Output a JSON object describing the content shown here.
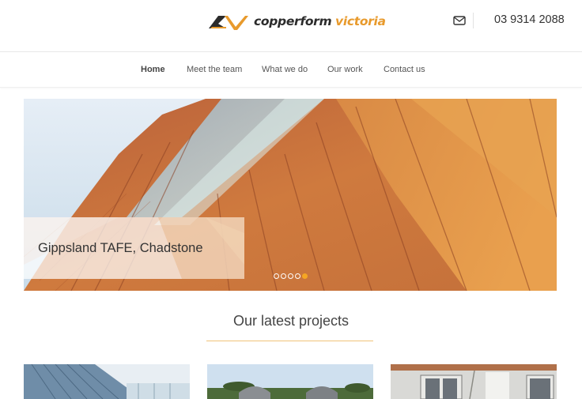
{
  "header": {
    "logo_word1": "copperform",
    "logo_word2": "victoria",
    "logo_icon": "cv-logo-mark",
    "mail_icon": "envelope-icon",
    "phone": "03 9314 2088"
  },
  "nav": {
    "items": [
      {
        "label": "Home",
        "active": true
      },
      {
        "label": "Meet the team",
        "active": false
      },
      {
        "label": "What we do",
        "active": false
      },
      {
        "label": "Our work",
        "active": false
      },
      {
        "label": "Contact us",
        "active": false
      }
    ]
  },
  "slider": {
    "caption": "Gippsland TAFE, Chadstone",
    "slide_count": 5,
    "active_slide": 5
  },
  "projects": {
    "title": "Our latest projects"
  },
  "colors": {
    "accent": "#f5a623",
    "copper": "#c8733a",
    "text": "#333333"
  }
}
